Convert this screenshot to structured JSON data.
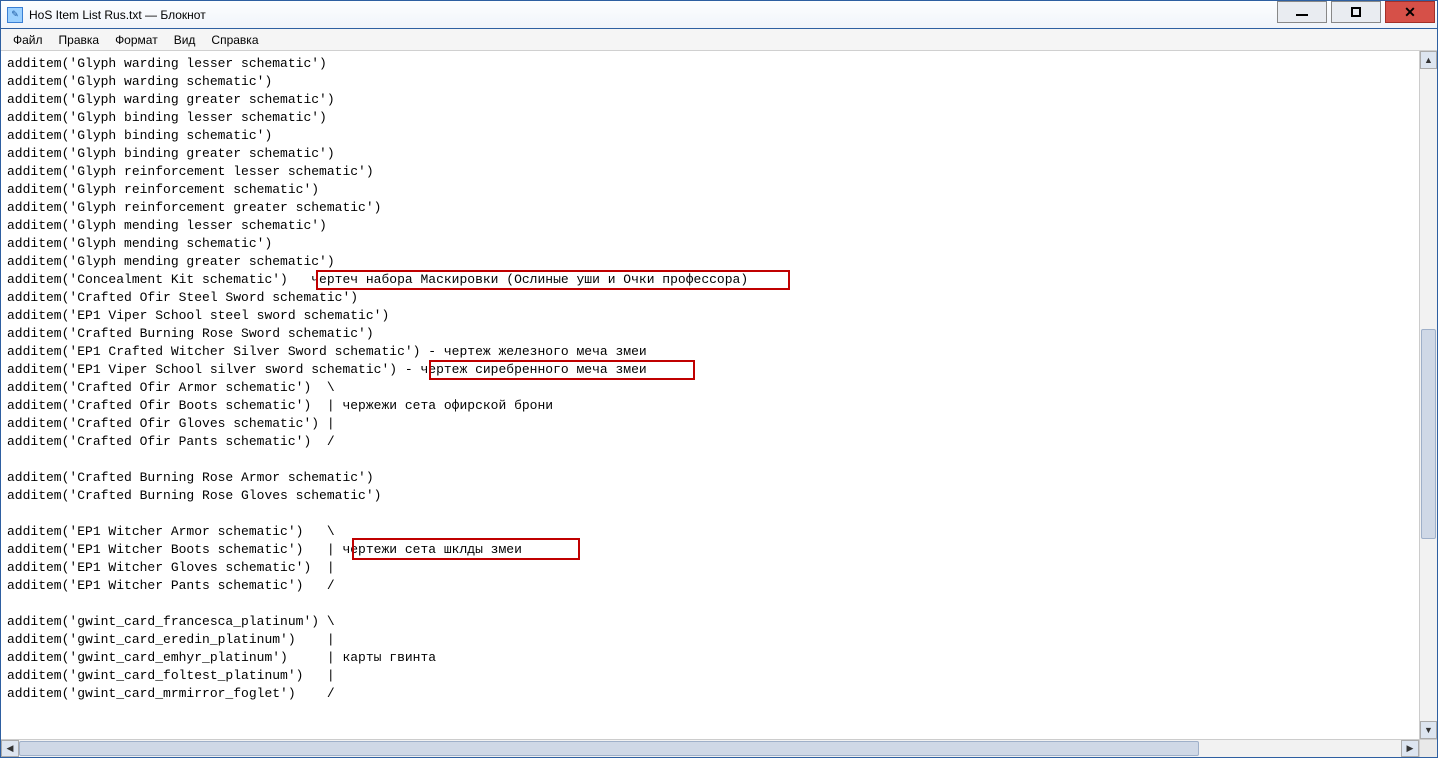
{
  "window": {
    "title": "HoS Item List Rus.txt — Блокнот"
  },
  "menu": {
    "file": "Файл",
    "edit": "Правка",
    "format": "Формат",
    "view": "Вид",
    "help": "Справка"
  },
  "lines": [
    "additem('Glyph warding lesser schematic')",
    "additem('Glyph warding schematic')",
    "additem('Glyph warding greater schematic')",
    "additem('Glyph binding lesser schematic')",
    "additem('Glyph binding schematic')",
    "additem('Glyph binding greater schematic')",
    "additem('Glyph reinforcement lesser schematic')",
    "additem('Glyph reinforcement schematic')",
    "additem('Glyph reinforcement greater schematic')",
    "additem('Glyph mending lesser schematic')",
    "additem('Glyph mending schematic')",
    "additem('Glyph mending greater schematic')",
    "additem('Concealment Kit schematic')   чертеч набора Маскировки (Ослиные уши и Очки профессора) ",
    "additem('Crafted Ofir Steel Sword schematic')",
    "additem('EP1 Viper School steel sword schematic')",
    "additem('Crafted Burning Rose Sword schematic')",
    "additem('EP1 Crafted Witcher Silver Sword schematic') - чертеж железного меча змеи",
    "additem('EP1 Viper School silver sword schematic') - чертеж сиребренного меча змеи ",
    "additem('Crafted Ofir Armor schematic')  \\",
    "additem('Crafted Ofir Boots schematic')  | чержежи сета офирской брони",
    "additem('Crafted Ofir Gloves schematic') |",
    "additem('Crafted Ofir Pants schematic')  /",
    "",
    "additem('Crafted Burning Rose Armor schematic')",
    "additem('Crafted Burning Rose Gloves schematic')",
    "",
    "additem('EP1 Witcher Armor schematic')   \\",
    "additem('EP1 Witcher Boots schematic')   | чертежи сета шклды змеи ",
    "additem('EP1 Witcher Gloves schematic')  |",
    "additem('EP1 Witcher Pants schematic')   /",
    "",
    "additem('gwint_card_francesca_platinum') \\",
    "additem('gwint_card_eredin_platinum')    |",
    "additem('gwint_card_emhyr_platinum')     | карты гвинта",
    "additem('gwint_card_foltest_platinum')   |",
    "additem('gwint_card_mrmirror_foglet')    /"
  ],
  "annotations": {
    "box1_text": "чертеч набора Маскировки (Ослиные уши и Очки профессора)",
    "box2_text": "чертеж сиребренного меча змеи",
    "box3_text": "чертежи сета шклды змеи"
  }
}
